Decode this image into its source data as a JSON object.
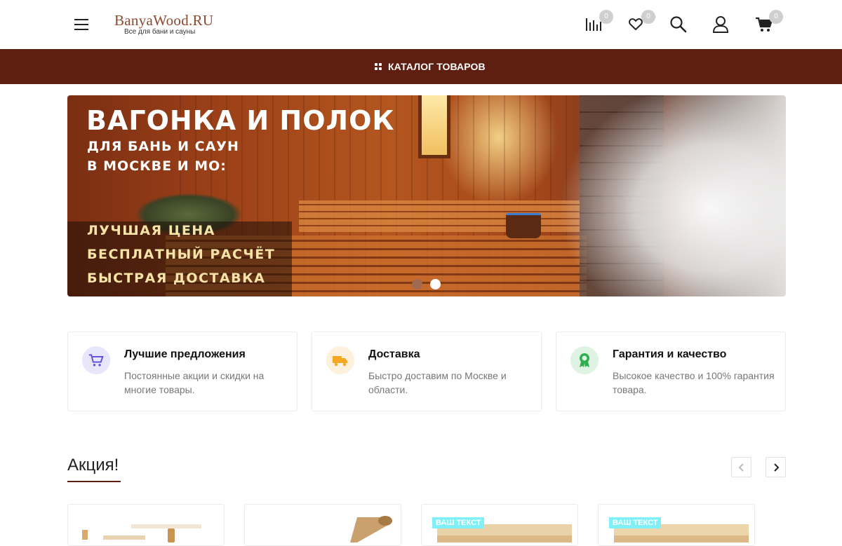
{
  "header": {
    "logo_main": "BanyaWood.RU",
    "logo_sub": "Все для бани и сауны",
    "compare_count": "0",
    "favorites_count": "0",
    "cart_count": "0",
    "icons": [
      "menu-icon",
      "compare-icon",
      "heart-icon",
      "search-icon",
      "user-icon",
      "cart-icon"
    ]
  },
  "catalog_bar": {
    "label": "КАТАЛОГ ТОВАРОВ",
    "bg_color": "#5e1f10"
  },
  "banner": {
    "title": "ВАГОНКА И ПОЛОК",
    "subtitle_lines": [
      "ДЛЯ БАНЬ И САУН",
      "В МОСКВЕ И МО:"
    ],
    "features": [
      "ЛУЧШАЯ ЦЕНА",
      "БЕСПЛАТНЫЙ РАСЧЁТ",
      "БЫСТРАЯ ДОСТАВКА"
    ],
    "slides_total": 2,
    "active_slide": 2
  },
  "features": [
    {
      "title": "Лучшие предложения",
      "text": "Постоянные акции и скидки на многие товары.",
      "icon": "cart-icon",
      "color": "#5a4fd6"
    },
    {
      "title": "Доставка",
      "text": "Быстро доставим по Москве и области.",
      "icon": "truck-icon",
      "color": "#f5a623"
    },
    {
      "title": "Гарантия и качество",
      "text": "Высокое качество и 100% гарантия товара.",
      "icon": "award-icon",
      "color": "#2fae4f"
    }
  ],
  "section": {
    "title": "Акция!",
    "cards": [
      {
        "tag": ""
      },
      {
        "tag": ""
      },
      {
        "tag": "ВАШ ТЕКСТ"
      },
      {
        "tag": "ВАШ ТЕКСТ"
      }
    ]
  }
}
